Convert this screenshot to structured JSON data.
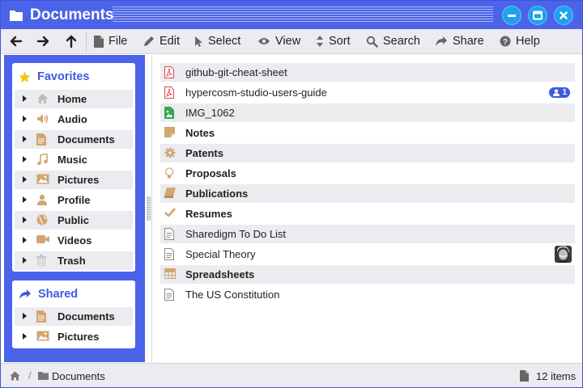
{
  "window": {
    "title": "Documents",
    "folder_icon": "folder-icon",
    "controls": [
      "minimize-icon",
      "maximize-icon",
      "close-icon"
    ]
  },
  "toolbar": {
    "nav": [
      "arrow-left-icon",
      "arrow-right-icon",
      "arrow-up-icon"
    ],
    "items": [
      {
        "label": "File",
        "icon": "file-icon"
      },
      {
        "label": "Edit",
        "icon": "pencil-icon"
      },
      {
        "label": "Select",
        "icon": "cursor-icon"
      },
      {
        "label": "View",
        "icon": "eye-icon"
      },
      {
        "label": "Sort",
        "icon": "sort-icon"
      },
      {
        "label": "Search",
        "icon": "search-icon"
      },
      {
        "label": "Share",
        "icon": "share-icon"
      },
      {
        "label": "Help",
        "icon": "help-icon"
      }
    ]
  },
  "sidebar": {
    "favorites": {
      "title": "Favorites",
      "icon": "star-icon",
      "items": [
        {
          "label": "Home",
          "icon": "home-icon"
        },
        {
          "label": "Audio",
          "icon": "speaker-icon"
        },
        {
          "label": "Documents",
          "icon": "document-icon"
        },
        {
          "label": "Music",
          "icon": "music-note-icon"
        },
        {
          "label": "Pictures",
          "icon": "image-icon"
        },
        {
          "label": "Profile",
          "icon": "user-icon"
        },
        {
          "label": "Public",
          "icon": "globe-icon"
        },
        {
          "label": "Videos",
          "icon": "video-camera-icon"
        },
        {
          "label": "Trash",
          "icon": "trash-icon"
        }
      ]
    },
    "shared": {
      "title": "Shared",
      "icon": "share-icon",
      "items": [
        {
          "label": "Documents",
          "icon": "document-icon"
        },
        {
          "label": "Pictures",
          "icon": "image-icon"
        }
      ]
    }
  },
  "files": [
    {
      "label": "github-git-cheat-sheet",
      "icon": "pdf-icon",
      "kind": "file"
    },
    {
      "label": "hypercosm-studio-users-guide",
      "icon": "pdf-icon",
      "kind": "file",
      "shared_count": "1"
    },
    {
      "label": "IMG_1062",
      "icon": "image-file-icon",
      "kind": "file"
    },
    {
      "label": "Notes",
      "icon": "sticky-note-icon",
      "kind": "folder"
    },
    {
      "label": "Patents",
      "icon": "gear-icon",
      "kind": "folder"
    },
    {
      "label": "Proposals",
      "icon": "lightbulb-icon",
      "kind": "folder"
    },
    {
      "label": "Publications",
      "icon": "book-icon",
      "kind": "folder"
    },
    {
      "label": "Resumes",
      "icon": "checkmark-icon",
      "kind": "folder"
    },
    {
      "label": "Sharedigm To Do List",
      "icon": "text-file-icon",
      "kind": "file"
    },
    {
      "label": "Special Theory",
      "icon": "text-file-icon",
      "kind": "file",
      "has_avatar": true
    },
    {
      "label": "Spreadsheets",
      "icon": "table-icon",
      "kind": "folder"
    },
    {
      "label": "The US Constitution",
      "icon": "text-file-icon",
      "kind": "file"
    }
  ],
  "statusbar": {
    "crumb_separator": "/",
    "crumb": "Documents",
    "count": "12 items"
  },
  "colors": {
    "accent": "#4a63e8",
    "window_button": "#1fa1ee",
    "folder_icon": "#d2a670",
    "pdf_icon": "#e0474c",
    "image_file_icon": "#35a853",
    "star": "#f6c419"
  }
}
